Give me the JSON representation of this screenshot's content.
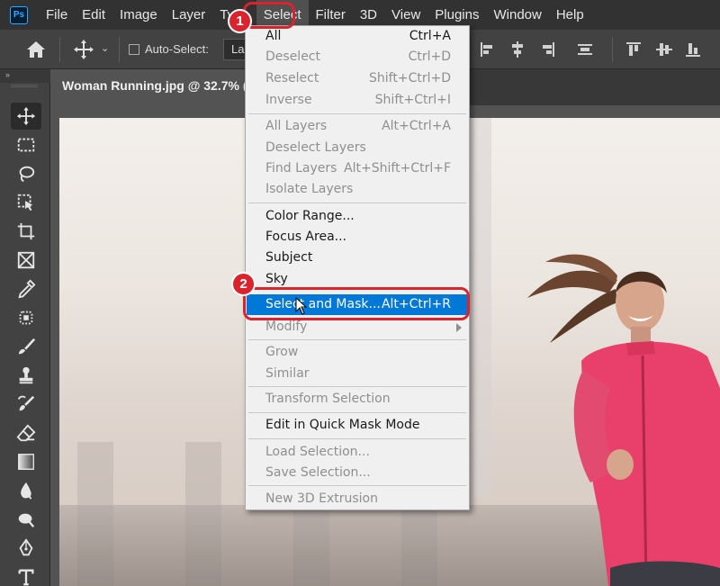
{
  "app": {
    "logo_text": "Ps",
    "brand_color": "#31a8ff"
  },
  "menubar": {
    "items": [
      "File",
      "Edit",
      "Image",
      "Layer",
      "Type",
      "Select",
      "Filter",
      "3D",
      "View",
      "Plugins",
      "Window",
      "Help"
    ],
    "active": "Select"
  },
  "options_bar": {
    "auto_select_label": "Auto-Select:",
    "auto_select_checked": false,
    "layer_dropdown_value": "La"
  },
  "tab": {
    "title": "Woman Running.jpg @ 32.7% (",
    "collapse_label": "»"
  },
  "select_menu": {
    "items": {
      "all": {
        "label": "All",
        "shortcut": "Ctrl+A",
        "enabled": true
      },
      "deselect": {
        "label": "Deselect",
        "shortcut": "Ctrl+D",
        "enabled": false
      },
      "reselect": {
        "label": "Reselect",
        "shortcut": "Shift+Ctrl+D",
        "enabled": false
      },
      "inverse": {
        "label": "Inverse",
        "shortcut": "Shift+Ctrl+I",
        "enabled": false
      },
      "all_layers": {
        "label": "All Layers",
        "shortcut": "Alt+Ctrl+A",
        "enabled": false
      },
      "deselect_layers": {
        "label": "Deselect Layers",
        "shortcut": "",
        "enabled": false
      },
      "find_layers": {
        "label": "Find Layers",
        "shortcut": "Alt+Shift+Ctrl+F",
        "enabled": false
      },
      "isolate_layers": {
        "label": "Isolate Layers",
        "shortcut": "",
        "enabled": false
      },
      "color_range": {
        "label": "Color Range...",
        "shortcut": "",
        "enabled": true
      },
      "focus_area": {
        "label": "Focus Area...",
        "shortcut": "",
        "enabled": true
      },
      "subject": {
        "label": "Subject",
        "shortcut": "",
        "enabled": true
      },
      "sky": {
        "label": "Sky",
        "shortcut": "",
        "enabled": true
      },
      "select_and_mask": {
        "label": "Select and Mask...",
        "shortcut": "Alt+Ctrl+R",
        "enabled": true,
        "highlighted": true
      },
      "modify": {
        "label": "Modify",
        "shortcut": "",
        "enabled": false,
        "submenu": true
      },
      "grow": {
        "label": "Grow",
        "shortcut": "",
        "enabled": false
      },
      "similar": {
        "label": "Similar",
        "shortcut": "",
        "enabled": false
      },
      "transform_selection": {
        "label": "Transform Selection",
        "shortcut": "",
        "enabled": false
      },
      "edit_quick_mask": {
        "label": "Edit in Quick Mask Mode",
        "shortcut": "",
        "enabled": true
      },
      "load_selection": {
        "label": "Load Selection...",
        "shortcut": "",
        "enabled": false
      },
      "save_selection": {
        "label": "Save Selection...",
        "shortcut": "",
        "enabled": false
      },
      "new_3d_extrusion": {
        "label": "New 3D Extrusion",
        "shortcut": "",
        "enabled": false
      }
    }
  },
  "callouts": {
    "step1": "1",
    "step2": "2",
    "color": "#d9232d"
  },
  "colors": {
    "highlight": "#0078d7",
    "menu_bg": "#f0f0f0",
    "ui_dark": "#323232"
  },
  "tools": [
    "move-tool",
    "marquee-tool",
    "lasso-tool",
    "object-select-tool",
    "crop-tool",
    "frame-tool",
    "eyedropper-tool",
    "spot-healing-tool",
    "brush-tool",
    "clone-stamp-tool",
    "history-brush-tool",
    "eraser-tool",
    "gradient-tool",
    "blur-tool",
    "dodge-tool",
    "pen-tool",
    "type-tool"
  ]
}
